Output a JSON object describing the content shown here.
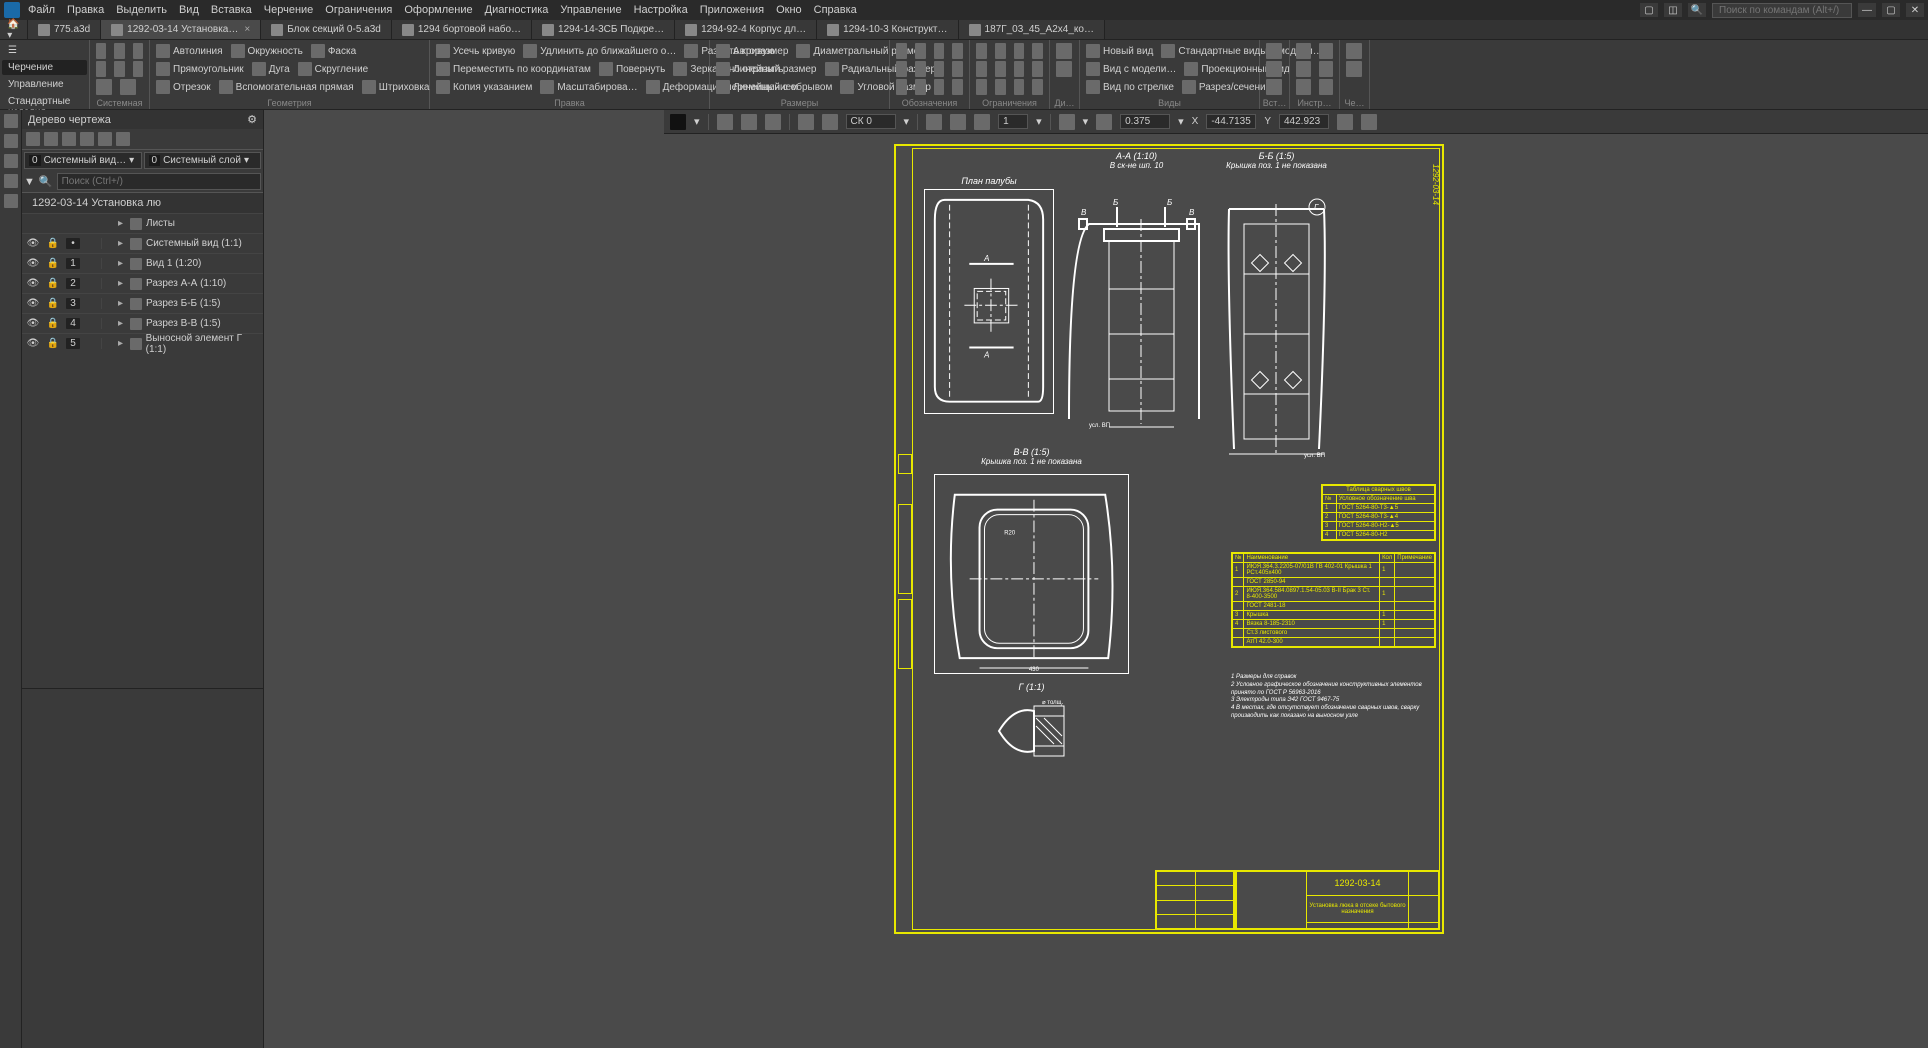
{
  "menu": [
    "Файл",
    "Правка",
    "Выделить",
    "Вид",
    "Вставка",
    "Черчение",
    "Ограничения",
    "Оформление",
    "Диагностика",
    "Управление",
    "Настройка",
    "Приложения",
    "Окно",
    "Справка"
  ],
  "search_placeholder": "Поиск по командам (Alt+/)",
  "doctabs": [
    {
      "label": "775.a3d",
      "active": false
    },
    {
      "label": "1292-03-14 Установка…",
      "active": true
    },
    {
      "label": "Блок секций 0-5.a3d",
      "active": false
    },
    {
      "label": "1294 бортовой набо…",
      "active": false
    },
    {
      "label": "1294-14-3СБ Подкре…",
      "active": false
    },
    {
      "label": "1294-92-4 Корпус дл…",
      "active": false
    },
    {
      "label": "1294-10-3 Конструкт…",
      "active": false
    },
    {
      "label": "187Г_03_45_А2х4_ко…",
      "active": false
    }
  ],
  "ribbon_tabs": [
    "Черчение",
    "Управление",
    "Стандартные изделия"
  ],
  "ribbon_panels": {
    "system": "Системная",
    "geometry": {
      "title": "Геометрия",
      "items": [
        "Автолиния",
        "Прямоугольник",
        "Отрезок",
        "Окружность",
        "Дуга",
        "Вспомогательная прямая",
        "Фаска",
        "Скругление",
        "Штриховка"
      ]
    },
    "edit": {
      "title": "Правка",
      "items": [
        "Усечь кривую",
        "Переместить по координатам",
        "Копия указанием",
        "Удлинить до ближайшего о…",
        "Повернуть",
        "Масштабирова…",
        "Разбить кривую",
        "Зеркально отразить",
        "Деформация перемещением"
      ]
    },
    "dims": {
      "title": "Размеры",
      "items": [
        "Авторазмер",
        "Линейный размер",
        "Линейный с обрывом",
        "Диаметральный размер",
        "Радиальный размер",
        "Угловой размер"
      ]
    },
    "annot": {
      "title": "Обозначения"
    },
    "constr": {
      "title": "Ограничения"
    },
    "diag": {
      "title": "Ди…"
    },
    "views": {
      "title": "Виды",
      "items": [
        "Новый вид",
        "Вид с модели…",
        "Вид по стрелке",
        "Стандартные виды с модели…",
        "Проекционный вид",
        "Разрез/сечение"
      ]
    },
    "insert": {
      "title": "Вст…"
    },
    "tools": {
      "title": "Инстр…"
    },
    "draw": {
      "title": "Че…"
    }
  },
  "tree": {
    "title": "Дерево чертежа",
    "dd1": "Системный вид…",
    "dd2": "Системный слой",
    "search_placeholder": "Поиск (Ctrl+/)",
    "root": "1292-03-14 Установка лю",
    "sheets": "Листы",
    "rows": [
      {
        "idx": "",
        "label": "Системный вид (1:1)"
      },
      {
        "idx": "1",
        "label": "Вид 1 (1:20)"
      },
      {
        "idx": "2",
        "label": "Разрез А-А (1:10)"
      },
      {
        "idx": "3",
        "label": "Разрез Б-Б (1:5)"
      },
      {
        "idx": "4",
        "label": "Разрез В-В (1:5)"
      },
      {
        "idx": "5",
        "label": "Выносной элемент Г (1:1)"
      }
    ]
  },
  "canvas_toolbar": {
    "snap": "СК 0",
    "step": "1",
    "zoom": "0.375",
    "x": "-44.7135",
    "y": "442.923"
  },
  "views": {
    "plan": {
      "title": "План палубы"
    },
    "aa": {
      "title": "А-А (1:10)",
      "sub": "В ск-не шп. 10"
    },
    "bb": {
      "title": "Б-Б (1:5)",
      "sub": "Крышка поз. 1 не показана"
    },
    "vv": {
      "title": "В-В (1:5)",
      "sub": "Крышка поз. 1 не показана"
    },
    "g": {
      "title": "Г (1:1)"
    },
    "side_label": "1292-03-14"
  },
  "weld_table": {
    "title": "Таблица сварных швов",
    "header": "Условное обозначение шва",
    "rows": [
      "ГОСТ 5264-80-Т3-▲5",
      "ГОСТ 5264-80-Т3-▲4",
      "ГОСТ 5264-80-Н2-▲5",
      "ГОСТ 5264-80-Н2"
    ]
  },
  "parts_table": {
    "headers": [
      "Наименование",
      "Кол",
      "Примечание"
    ],
    "rows": [
      "ИЮЯ.364.3.2205-07/01В ГВ 402-01 Крышка 1 РСт.405х400",
      "ГОСТ 2850-94",
      "ИЮЯ.364.584.0897.1.54-05.03 В-II Брак 3 Ст. 8-400-3500",
      "ГОСТ 2481-18",
      "Крышка",
      "Вязка 8-185-2310",
      "Ст.3 листового",
      "АтП 42.0-300"
    ]
  },
  "notes": [
    "1 Размеры для справок",
    "2 Условное графическое обозначение конструктивных элементов принято по ГОСТ Р 56963-2016",
    "3 Электроды типа Э42 ГОСТ 9467-75",
    "4 В местах, где отсутствует обозначение сварных швов, сварку производить как показано на выносном узле"
  ],
  "title_block": {
    "number": "1292-03-14",
    "name": "Установка люка в отсеке бытового назначения"
  }
}
